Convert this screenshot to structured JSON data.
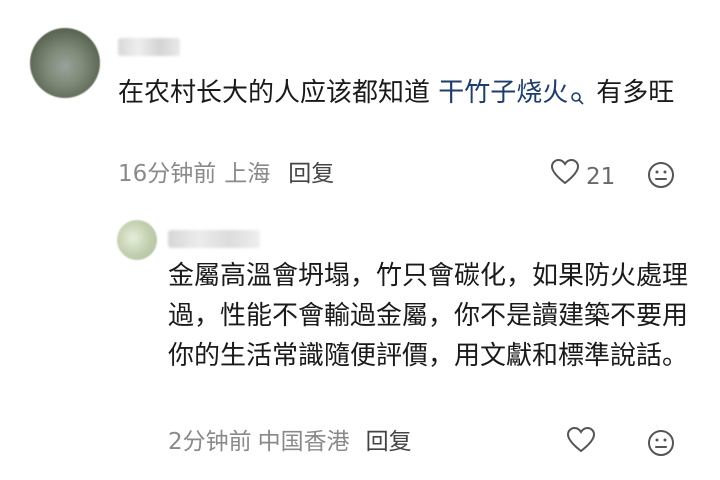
{
  "comment": {
    "text_before": "在农村长大的人应该都知道 ",
    "highlight": "干竹子烧火",
    "text_after": "有多旺",
    "time": "16分钟前",
    "location": "上海",
    "reply_label": "回复",
    "like_count": "21"
  },
  "reply": {
    "text": "金屬高溫會坍塌，竹只會碳化，如果防火處理過，性能不會輸過金屬，你不是讀建築不要用你的生活常識隨便評價，用文獻和標準說話。",
    "time": "2分钟前",
    "location": "中国香港",
    "reply_label": "回复"
  },
  "icons": {
    "search": "search-icon",
    "like": "heart-outline-icon",
    "emoji": "neutral-face-icon"
  },
  "colors": {
    "text": "#1a1a1a",
    "meta": "#8a8a8a",
    "link": "#1f3d6b",
    "icon": "#555555"
  }
}
